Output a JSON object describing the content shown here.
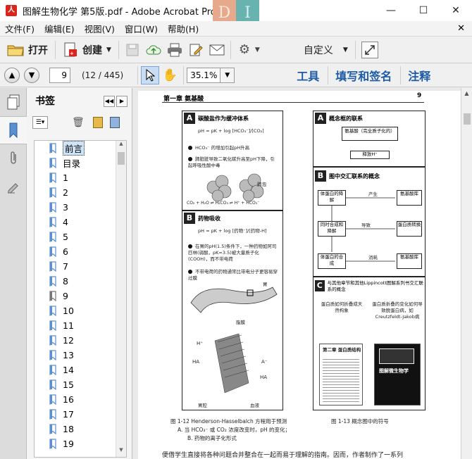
{
  "window": {
    "title": "图解生物化学 第5版.pdf - Adobe Acrobat Pro",
    "watermark_letters": [
      "D",
      "I"
    ]
  },
  "menu": [
    "文件(F)",
    "编辑(E)",
    "视图(V)",
    "窗口(W)",
    "帮助(H)"
  ],
  "toolbar": {
    "open_label": "打开",
    "create_label": "创建",
    "custom_label": "自定义",
    "tools_label": "工具",
    "fill_sign_label": "填写和签名",
    "comment_label": "注释"
  },
  "nav": {
    "page_value": "9",
    "page_count": "(12 / 445)",
    "zoom_value": "35.1%"
  },
  "panel": {
    "title": "书签",
    "bookmarks": [
      "前言",
      "目录",
      "1",
      "2",
      "3",
      "4",
      "5",
      "6",
      "7",
      "8",
      "9",
      "10",
      "11",
      "12",
      "13",
      "14",
      "15",
      "16",
      "17",
      "18",
      "19"
    ],
    "selected_index": 0
  },
  "doc": {
    "chapter": "第一章  氨基酸",
    "page_number": "9",
    "figA_title": "碳酸盐作为缓冲体系",
    "figA_eq": "pH = pK + log [HCO₃⁻]/[CO₂]",
    "figA_b1": "HCO₃⁻ 的增加引起pH升高",
    "figA_b2": "肺脏脏导致二氧化碳升高至pH下降，引起呼吸性酸中毒",
    "figA_lung": "肺泡",
    "figA_reaction": "CO₂ + H₂O ⇌ H₂CO₃ ⇌ H⁺ + HCO₃⁻",
    "figB_title": "药物吸收",
    "figB_eq": "pH = pK + log [药物⁻]/[药物-H]",
    "figB_b1": "在胃的pH(1.5)条件下，一种药物如阿司匹林(弱酸，pK=3.5)被大量质子化(COOH)，而不带电荷",
    "figB_b2": "不带电荷的药物通常比带电分子更容易穿过膜",
    "figB_stomach": "胃",
    "figB_membrane": "脂膜",
    "figB_lumen": "胃腔",
    "figB_blood": "血液",
    "caption_left_1": "图 1-12   Henderson-Hasselbalch 方程用于预测",
    "caption_left_2": "A. 当 HCO₃⁻ 或 CO₂ 浓度改变时，pH 的变化；",
    "caption_left_3": "B. 药物的离子化形式",
    "right_A_title": "概念框的联系",
    "right_A_box1": "氨基酸（完全质子化的）",
    "right_A_box2": "释放H⁺",
    "right_B_title": "图中交汇联系的概念",
    "right_B_boxes": [
      "体蛋白的降解",
      "氨基酸库",
      "同时合成和降解",
      "蛋白质转换",
      "体蛋白的合成",
      "氨基酸库"
    ],
    "right_B_labels": [
      "产生",
      "导致",
      "消耗"
    ],
    "right_C_title": "与其他章节和其他Lippincott图解系列书交汇联系的概念",
    "right_C_left": "蛋白质如何折叠成天然构象",
    "right_C_right": "蛋白质折叠的变化如何导致脱蛋白病，如Creutzfeldt-Jakob病",
    "right_C_book": "图解微生物学",
    "right_C_chapter": "第二章  蛋白质结构",
    "caption_right": "图 1-13   概念图中的符号",
    "body_text": "便借学生直接将各种问题合并整合在一起而易于理解的指南。因而，作者制作了一系列"
  }
}
